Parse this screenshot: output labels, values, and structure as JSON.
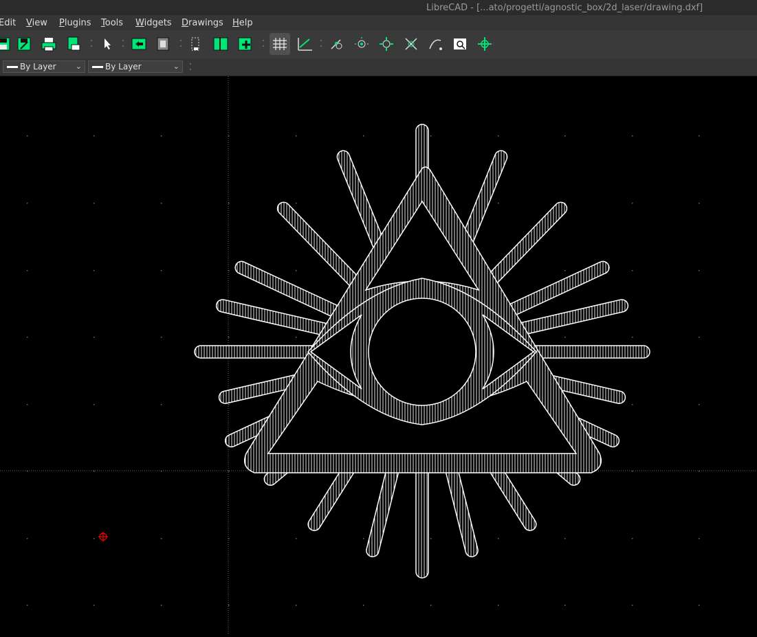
{
  "window": {
    "title": "LibreCAD - [...ato/progetti/agnostic_box/2d_laser/drawing.dxf]"
  },
  "menu": [
    {
      "label": "Edit",
      "accel": ""
    },
    {
      "label": "View",
      "accel": "V"
    },
    {
      "label": "Plugins",
      "accel": "P"
    },
    {
      "label": "Tools",
      "accel": "T"
    },
    {
      "label": "Widgets",
      "accel": "W"
    },
    {
      "label": "Drawings",
      "accel": "D"
    },
    {
      "label": "Help",
      "accel": "H"
    }
  ],
  "toolbar": {
    "icons": [
      "save-icon",
      "save-as-icon",
      "print-icon",
      "print-preview-icon",
      "select-pointer-icon",
      "block-insert-icon",
      "block-edit-icon",
      "layer-list-icon",
      "block-list-icon",
      "new-block-icon",
      "grid-icon",
      "draft-mode-icon",
      "snap-free-icon",
      "snap-grid-icon",
      "snap-endpoint-icon",
      "snap-intersection-icon",
      "snap-on-entity-icon",
      "zoom-window-icon",
      "relative-zero-icon"
    ],
    "active": "grid-icon",
    "accent_color": "#00ff80"
  },
  "properties": {
    "line_type": "By Layer",
    "line_width": "By Layer"
  },
  "canvas": {
    "background_color": "#000000",
    "entity_color": "#ffffff",
    "origin_marker_color": "#ff0000",
    "grid_dot_color": "#7a7a7a"
  }
}
